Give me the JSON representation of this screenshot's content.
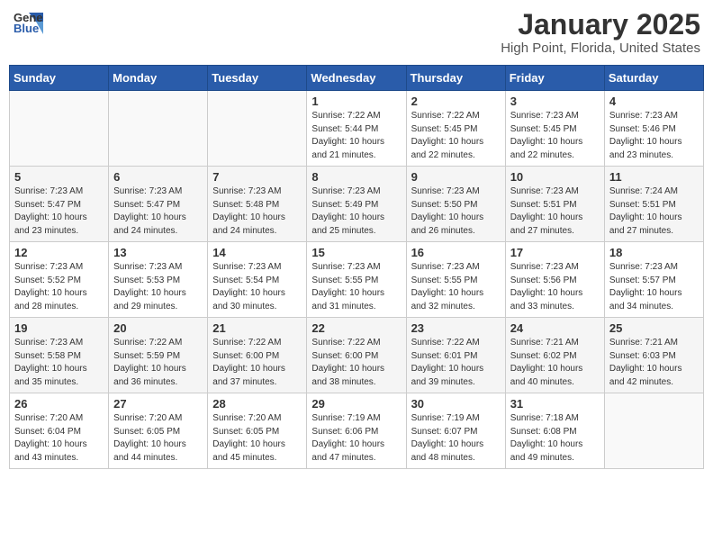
{
  "header": {
    "logo_line1": "General",
    "logo_line2": "Blue",
    "month_title": "January 2025",
    "location": "High Point, Florida, United States"
  },
  "weekdays": [
    "Sunday",
    "Monday",
    "Tuesday",
    "Wednesday",
    "Thursday",
    "Friday",
    "Saturday"
  ],
  "weeks": [
    [
      {
        "day": "",
        "info": ""
      },
      {
        "day": "",
        "info": ""
      },
      {
        "day": "",
        "info": ""
      },
      {
        "day": "1",
        "info": "Sunrise: 7:22 AM\nSunset: 5:44 PM\nDaylight: 10 hours\nand 21 minutes."
      },
      {
        "day": "2",
        "info": "Sunrise: 7:22 AM\nSunset: 5:45 PM\nDaylight: 10 hours\nand 22 minutes."
      },
      {
        "day": "3",
        "info": "Sunrise: 7:23 AM\nSunset: 5:45 PM\nDaylight: 10 hours\nand 22 minutes."
      },
      {
        "day": "4",
        "info": "Sunrise: 7:23 AM\nSunset: 5:46 PM\nDaylight: 10 hours\nand 23 minutes."
      }
    ],
    [
      {
        "day": "5",
        "info": "Sunrise: 7:23 AM\nSunset: 5:47 PM\nDaylight: 10 hours\nand 23 minutes."
      },
      {
        "day": "6",
        "info": "Sunrise: 7:23 AM\nSunset: 5:47 PM\nDaylight: 10 hours\nand 24 minutes."
      },
      {
        "day": "7",
        "info": "Sunrise: 7:23 AM\nSunset: 5:48 PM\nDaylight: 10 hours\nand 24 minutes."
      },
      {
        "day": "8",
        "info": "Sunrise: 7:23 AM\nSunset: 5:49 PM\nDaylight: 10 hours\nand 25 minutes."
      },
      {
        "day": "9",
        "info": "Sunrise: 7:23 AM\nSunset: 5:50 PM\nDaylight: 10 hours\nand 26 minutes."
      },
      {
        "day": "10",
        "info": "Sunrise: 7:23 AM\nSunset: 5:51 PM\nDaylight: 10 hours\nand 27 minutes."
      },
      {
        "day": "11",
        "info": "Sunrise: 7:24 AM\nSunset: 5:51 PM\nDaylight: 10 hours\nand 27 minutes."
      }
    ],
    [
      {
        "day": "12",
        "info": "Sunrise: 7:23 AM\nSunset: 5:52 PM\nDaylight: 10 hours\nand 28 minutes."
      },
      {
        "day": "13",
        "info": "Sunrise: 7:23 AM\nSunset: 5:53 PM\nDaylight: 10 hours\nand 29 minutes."
      },
      {
        "day": "14",
        "info": "Sunrise: 7:23 AM\nSunset: 5:54 PM\nDaylight: 10 hours\nand 30 minutes."
      },
      {
        "day": "15",
        "info": "Sunrise: 7:23 AM\nSunset: 5:55 PM\nDaylight: 10 hours\nand 31 minutes."
      },
      {
        "day": "16",
        "info": "Sunrise: 7:23 AM\nSunset: 5:55 PM\nDaylight: 10 hours\nand 32 minutes."
      },
      {
        "day": "17",
        "info": "Sunrise: 7:23 AM\nSunset: 5:56 PM\nDaylight: 10 hours\nand 33 minutes."
      },
      {
        "day": "18",
        "info": "Sunrise: 7:23 AM\nSunset: 5:57 PM\nDaylight: 10 hours\nand 34 minutes."
      }
    ],
    [
      {
        "day": "19",
        "info": "Sunrise: 7:23 AM\nSunset: 5:58 PM\nDaylight: 10 hours\nand 35 minutes."
      },
      {
        "day": "20",
        "info": "Sunrise: 7:22 AM\nSunset: 5:59 PM\nDaylight: 10 hours\nand 36 minutes."
      },
      {
        "day": "21",
        "info": "Sunrise: 7:22 AM\nSunset: 6:00 PM\nDaylight: 10 hours\nand 37 minutes."
      },
      {
        "day": "22",
        "info": "Sunrise: 7:22 AM\nSunset: 6:00 PM\nDaylight: 10 hours\nand 38 minutes."
      },
      {
        "day": "23",
        "info": "Sunrise: 7:22 AM\nSunset: 6:01 PM\nDaylight: 10 hours\nand 39 minutes."
      },
      {
        "day": "24",
        "info": "Sunrise: 7:21 AM\nSunset: 6:02 PM\nDaylight: 10 hours\nand 40 minutes."
      },
      {
        "day": "25",
        "info": "Sunrise: 7:21 AM\nSunset: 6:03 PM\nDaylight: 10 hours\nand 42 minutes."
      }
    ],
    [
      {
        "day": "26",
        "info": "Sunrise: 7:20 AM\nSunset: 6:04 PM\nDaylight: 10 hours\nand 43 minutes."
      },
      {
        "day": "27",
        "info": "Sunrise: 7:20 AM\nSunset: 6:05 PM\nDaylight: 10 hours\nand 44 minutes."
      },
      {
        "day": "28",
        "info": "Sunrise: 7:20 AM\nSunset: 6:05 PM\nDaylight: 10 hours\nand 45 minutes."
      },
      {
        "day": "29",
        "info": "Sunrise: 7:19 AM\nSunset: 6:06 PM\nDaylight: 10 hours\nand 47 minutes."
      },
      {
        "day": "30",
        "info": "Sunrise: 7:19 AM\nSunset: 6:07 PM\nDaylight: 10 hours\nand 48 minutes."
      },
      {
        "day": "31",
        "info": "Sunrise: 7:18 AM\nSunset: 6:08 PM\nDaylight: 10 hours\nand 49 minutes."
      },
      {
        "day": "",
        "info": ""
      }
    ]
  ]
}
